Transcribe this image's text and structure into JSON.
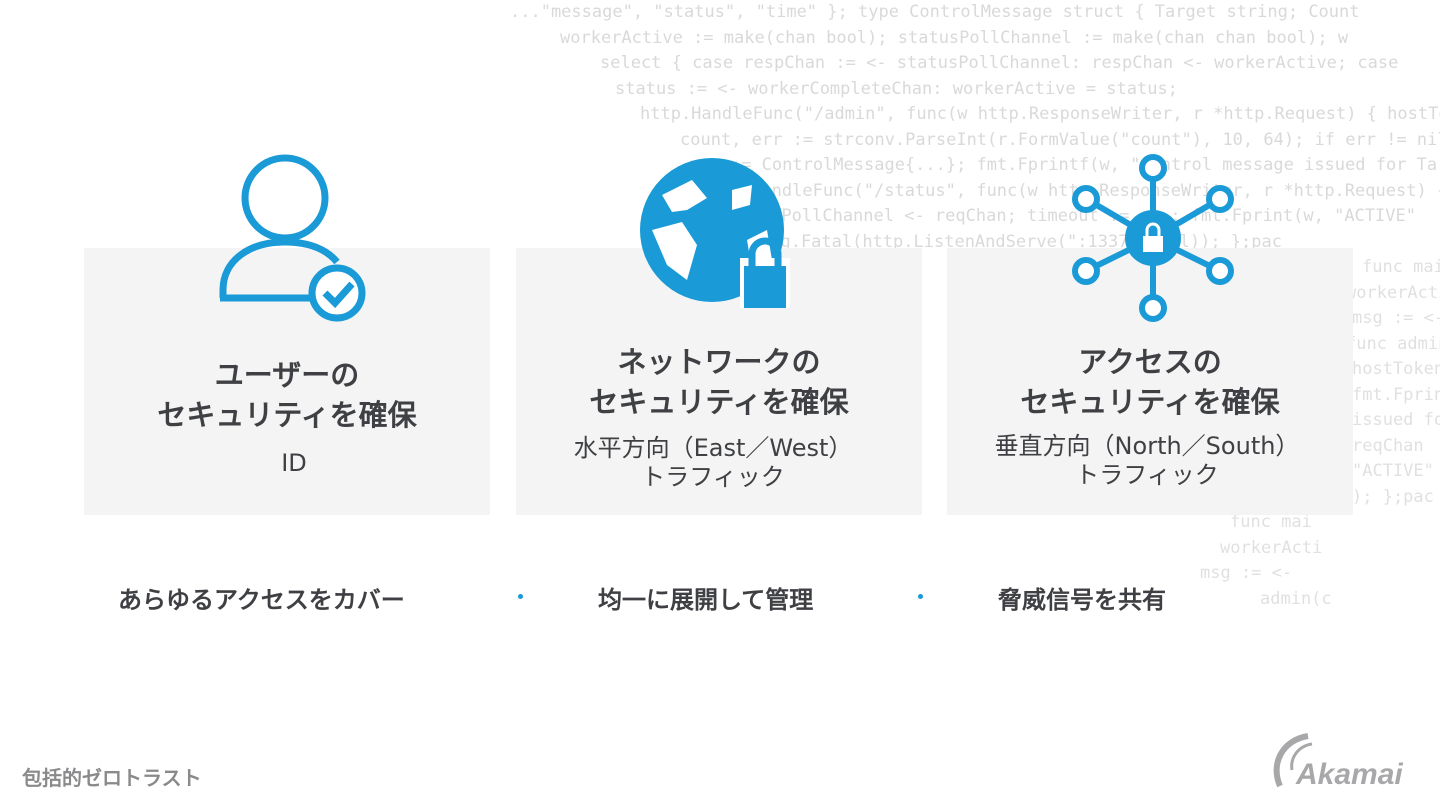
{
  "background_code": [
    "...\"message\", \"status\", \"time\" }; type ControlMessage struct { Target string; Count",
    "workerActive := make(chan bool); statusPollChannel := make(chan chan bool); w",
    "select { case respChan := <- statusPollChannel: respChan <- workerActive; case",
    "status := <- workerCompleteChan: workerActive = status;",
    "http.HandleFunc(\"/admin\", func(w http.ResponseWriter, r *http.Request) { hostTok",
    "count, err := strconv.ParseInt(r.FormValue(\"count\"), 10, 64); if err != nil { fmt.Fprintf(w,",
    "msg := ControlMessage{...}; fmt.Fprintf(w, \"Control message issued for Tar",
    "http.HandleFunc(\"/status\", func(w http.ResponseWriter, r *http.Request) { reqChan",
    "statusPollChannel <- reqChan; timeout := ...; fmt.Fprint(w, \"ACTIVE\"",
    "log.Fatal(http.ListenAndServe(\":1337\", nil)); };pac",
    "func mai",
    "workerActi",
    "msg := <-",
    "func admin(c",
    "hostTokens",
    "fmt.Fprintf(w,",
    "issued for Tar",
    "reqChan",
    "\"ACTIVE\"",
    "); };pac",
    "func mai",
    "workerActi",
    "msg := <-",
    "admin(c"
  ],
  "cards": [
    {
      "icon": "user-check-icon",
      "title_lines": [
        "ユーザーの",
        "セキュリティを確保"
      ],
      "sub_lines": [
        "ID"
      ]
    },
    {
      "icon": "globe-lock-icon",
      "title_lines": [
        "ネットワークの",
        "セキュリティを確保"
      ],
      "sub_lines": [
        "水平方向（East／West）",
        "トラフィック"
      ]
    },
    {
      "icon": "network-lock-icon",
      "title_lines": [
        "アクセスの",
        "セキュリティを確保"
      ],
      "sub_lines": [
        "垂直方向（North／South）",
        "トラフィック"
      ]
    }
  ],
  "bottom_items": [
    "あらゆるアクセスをカバー",
    "均一に展開して管理",
    "脅威信号を共有"
  ],
  "footer": "包括的ゼロトラスト",
  "logo_text": "Akamai",
  "colors": {
    "accent": "#1a9ad6",
    "text": "#3f4043",
    "card": "#f4f4f5"
  }
}
